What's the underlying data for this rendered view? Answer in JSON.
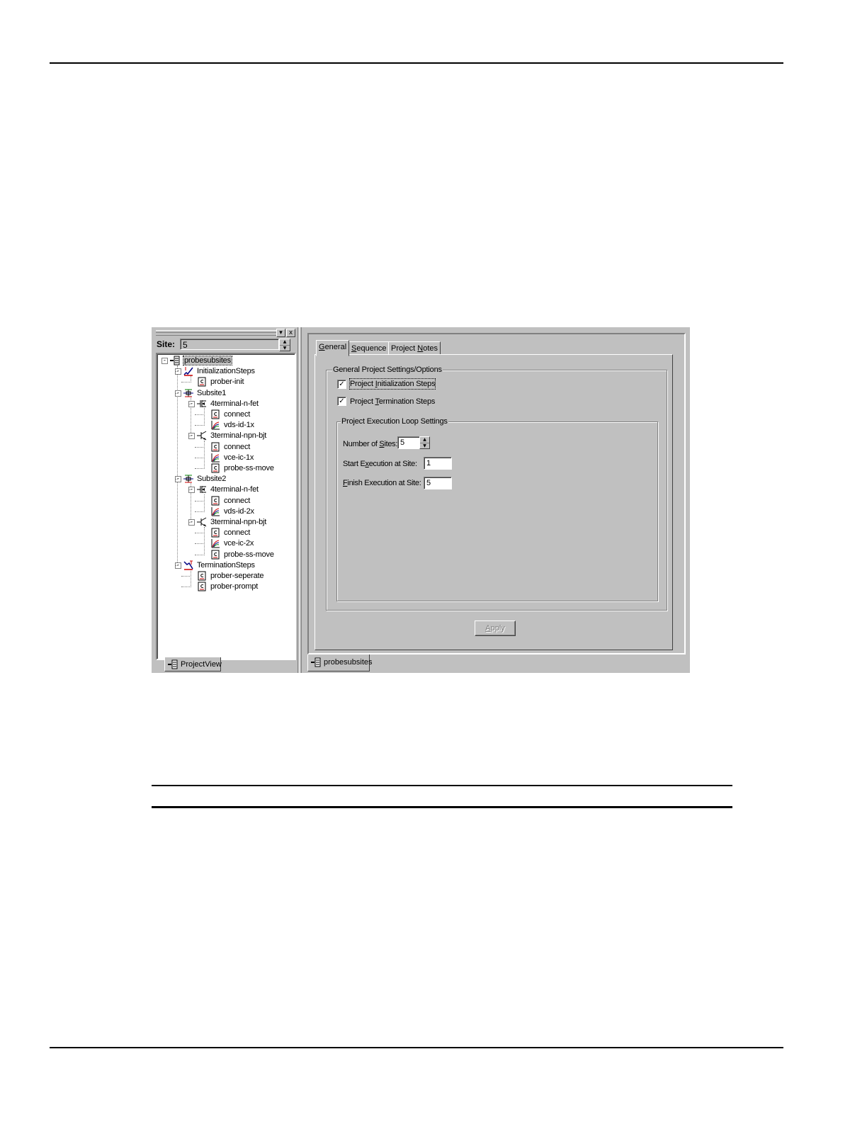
{
  "left_pane": {
    "close_glyph": "x",
    "menu_glyph": "▾",
    "site_label": "Site:",
    "site_value": "5",
    "bottom_tab": "ProjectView"
  },
  "tree": [
    {
      "label": "probesubsites",
      "icon": "project-icon"
    },
    {
      "label": "InitializationSteps",
      "icon": "init-steps-icon"
    },
    {
      "label": "prober-init",
      "icon": "script-icon"
    },
    {
      "label": "Subsite1",
      "icon": "subsite-icon"
    },
    {
      "label": "4terminal-n-fet",
      "icon": "fet-icon"
    },
    {
      "label": "connect",
      "icon": "script-icon"
    },
    {
      "label": "vds-id-1x",
      "icon": "curve-icon"
    },
    {
      "label": "3terminal-npn-bjt",
      "icon": "bjt-icon"
    },
    {
      "label": "connect",
      "icon": "script-icon"
    },
    {
      "label": "vce-ic-1x",
      "icon": "curve-icon"
    },
    {
      "label": "probe-ss-move",
      "icon": "script-icon"
    },
    {
      "label": "Subsite2",
      "icon": "subsite-icon"
    },
    {
      "label": "4terminal-n-fet",
      "icon": "fet-icon"
    },
    {
      "label": "connect",
      "icon": "script-icon"
    },
    {
      "label": "vds-id-2x",
      "icon": "curve-icon"
    },
    {
      "label": "3terminal-npn-bjt",
      "icon": "bjt-icon"
    },
    {
      "label": "connect",
      "icon": "script-icon"
    },
    {
      "label": "vce-ic-2x",
      "icon": "curve-icon"
    },
    {
      "label": "probe-ss-move",
      "icon": "script-icon"
    },
    {
      "label": "TerminationSteps",
      "icon": "term-steps-icon"
    },
    {
      "label": "prober-seperate",
      "icon": "script-icon"
    },
    {
      "label": "prober-prompt",
      "icon": "script-icon"
    }
  ],
  "tabs": {
    "general": {
      "pre": "",
      "u": "G",
      "post": "eneral"
    },
    "sequence": {
      "pre": "",
      "u": "S",
      "post": "equence"
    },
    "notes": {
      "pre": "Project ",
      "u": "N",
      "post": "otes"
    }
  },
  "general": {
    "group_title": "General Project Settings/Options",
    "init_steps": {
      "pre": "Project ",
      "u": "I",
      "post": "nitialization Steps",
      "checked": true
    },
    "term_steps": {
      "pre": "Project ",
      "u": "T",
      "post": "ermination Steps",
      "checked": true
    },
    "check_glyph": "✓",
    "loop_group_title": "Project Execution Loop Settings",
    "num_sites": {
      "pre": "Number of ",
      "u": "S",
      "post": "ites:",
      "value": "5"
    },
    "start_site": {
      "pre": "Start E",
      "u": "x",
      "post": "ecution at Site:",
      "value": "1"
    },
    "finish_site": {
      "pre": "",
      "u": "F",
      "post": "inish Execution at Site:",
      "value": "5"
    },
    "apply": {
      "pre": "",
      "u": "A",
      "post": "pply"
    }
  },
  "document_tab": "probesubsites",
  "colors": {
    "face": "#c0c0c0",
    "shadow": "#808080",
    "highlight": "#ffffff",
    "accent_red": "#cc0000",
    "accent_blue": "#000080"
  }
}
